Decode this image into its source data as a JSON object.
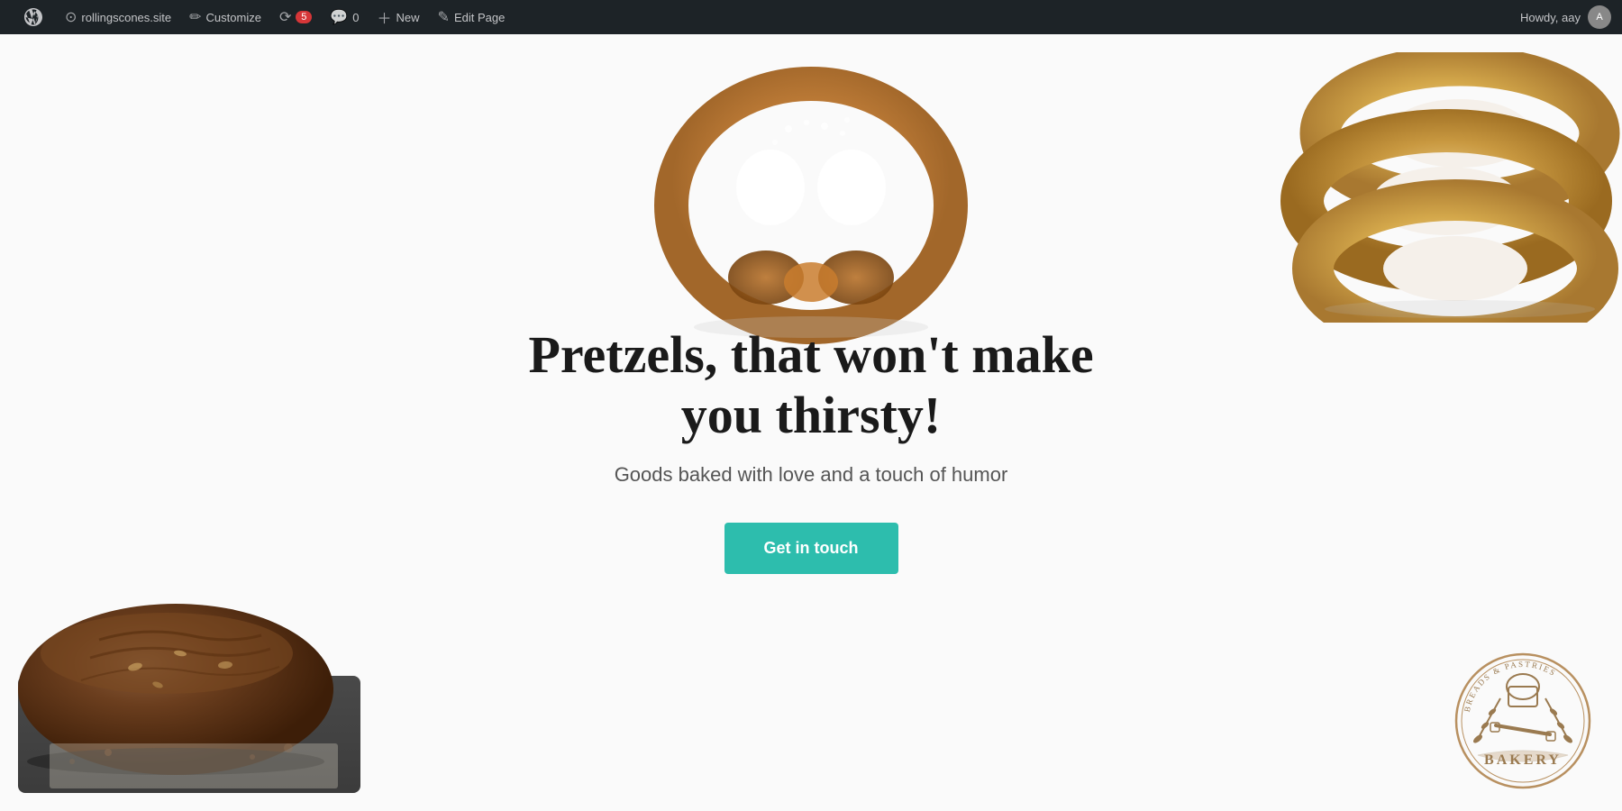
{
  "admin_bar": {
    "site_url": "rollingscones.site",
    "customize_label": "Customize",
    "updates_count": "5",
    "comments_count": "0",
    "new_label": "New",
    "edit_label": "Edit Page",
    "user_greeting": "Howdy, aay"
  },
  "hero": {
    "title": "Pretzels, that won't make you thirsty!",
    "subtitle": "Goods baked with love and a touch of humor",
    "cta_label": "Get in touch"
  },
  "bakery_logo": {
    "text": "BAKERY",
    "tagline": "BREADS & PASTRIES"
  },
  "colors": {
    "admin_bg": "#1d2327",
    "cta_bg": "#2dbdad",
    "title_color": "#1a1a1a",
    "subtitle_color": "#555555"
  }
}
